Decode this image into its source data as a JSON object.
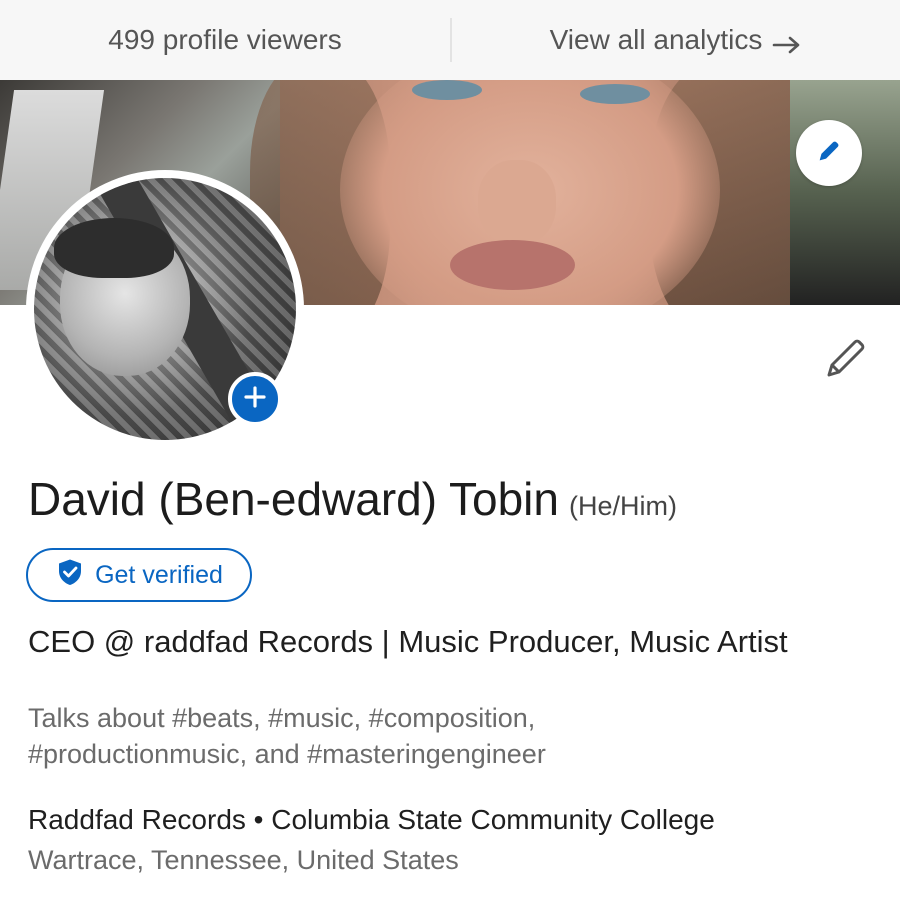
{
  "analytics": {
    "viewers_label": "499 profile viewers",
    "view_all_label": "View all analytics"
  },
  "profile": {
    "name": "David (Ben-edward) Tobin",
    "pronouns": "(He/Him)",
    "verify_label": "Get verified",
    "headline": "CEO @ raddfad Records | Music Producer, Music Artist",
    "talks_line1": "Talks about #beats, #music, #composition,",
    "talks_line2": "#productionmusic, and #masteringengineer",
    "experience": "Raddfad Records • Columbia State Community College",
    "location": "Wartrace, Tennessee, United States"
  },
  "icons": {
    "arrow": "arrow-right-icon",
    "edit_cover": "pencil-icon",
    "add_photo": "plus-icon",
    "edit_profile": "pencil-icon",
    "verified": "shield-check-icon"
  },
  "colors": {
    "accent": "#0a66c2",
    "text_primary": "#1f1f1f",
    "text_secondary": "#6b6b6b"
  }
}
